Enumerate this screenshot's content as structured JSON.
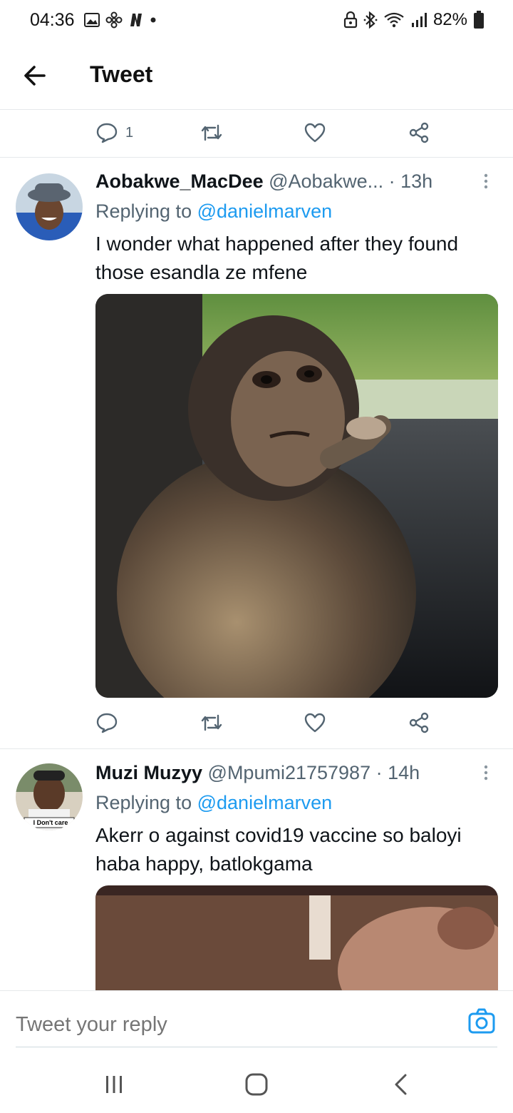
{
  "status_bar": {
    "time": "04:36",
    "battery": "82%",
    "icons_left": [
      "gallery-icon",
      "fan-icon",
      "netflix-n-icon",
      "dot-icon"
    ],
    "icons_right": [
      "lock-icon",
      "bluetooth-icon",
      "wifi-icon",
      "signal-icon",
      "battery-icon"
    ]
  },
  "header": {
    "title": "Tweet"
  },
  "top_actions": {
    "reply_count": "1"
  },
  "tweets": [
    {
      "name": "Aobakwe_MacDee",
      "handle": "@Aobakwe...",
      "time": "· 13h",
      "replying_prefix": "Replying to",
      "replying_to": "@danielmarven",
      "text": "I wonder what happened after they found those esandla ze mfene"
    },
    {
      "name": "Muzi Muzyy",
      "handle": "@Mpumi21757987",
      "time": "· 14h",
      "replying_prefix": "Replying to",
      "replying_to": "@danielmarven",
      "text": "Akerr o against covid19 vaccine so baloyi haba happy, batlokgama",
      "avatar_caption": "I Don't care"
    }
  ],
  "reply_bar": {
    "placeholder": "Tweet your reply"
  },
  "colors": {
    "accent": "#1d9bf0",
    "secondary_text": "#536471",
    "divider": "#e6e9eb"
  }
}
